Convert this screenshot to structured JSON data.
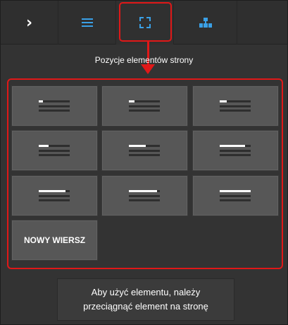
{
  "toolbar": {
    "tabs": [
      {
        "name": "expand",
        "icon": "chevron-right-icon",
        "glyph": "›"
      },
      {
        "name": "list",
        "icon": "hamburger-icon"
      },
      {
        "name": "elements",
        "icon": "dashed-square-icon"
      },
      {
        "name": "structure",
        "icon": "sitemap-icon"
      }
    ],
    "active_tab": "elements"
  },
  "section_title": "Pozycje elementów strony",
  "tiles": [
    {
      "id": "tile-1",
      "accent": "short"
    },
    {
      "id": "tile-2",
      "accent": "short"
    },
    {
      "id": "tile-3",
      "accent": "short"
    },
    {
      "id": "tile-4",
      "accent": "medium"
    },
    {
      "id": "tile-5",
      "accent": "medium"
    },
    {
      "id": "tile-6",
      "accent": "long"
    },
    {
      "id": "tile-7",
      "accent": "long"
    },
    {
      "id": "tile-8",
      "accent": "long"
    },
    {
      "id": "tile-9",
      "accent": "full"
    }
  ],
  "new_row_label": "NOWY WIERSZ",
  "hint": {
    "line1": "Aby użyć elementu, należy",
    "line2": "przeciągnąć element na stronę"
  },
  "colors": {
    "accent": "#3aa0e6",
    "highlight": "#e01818"
  }
}
